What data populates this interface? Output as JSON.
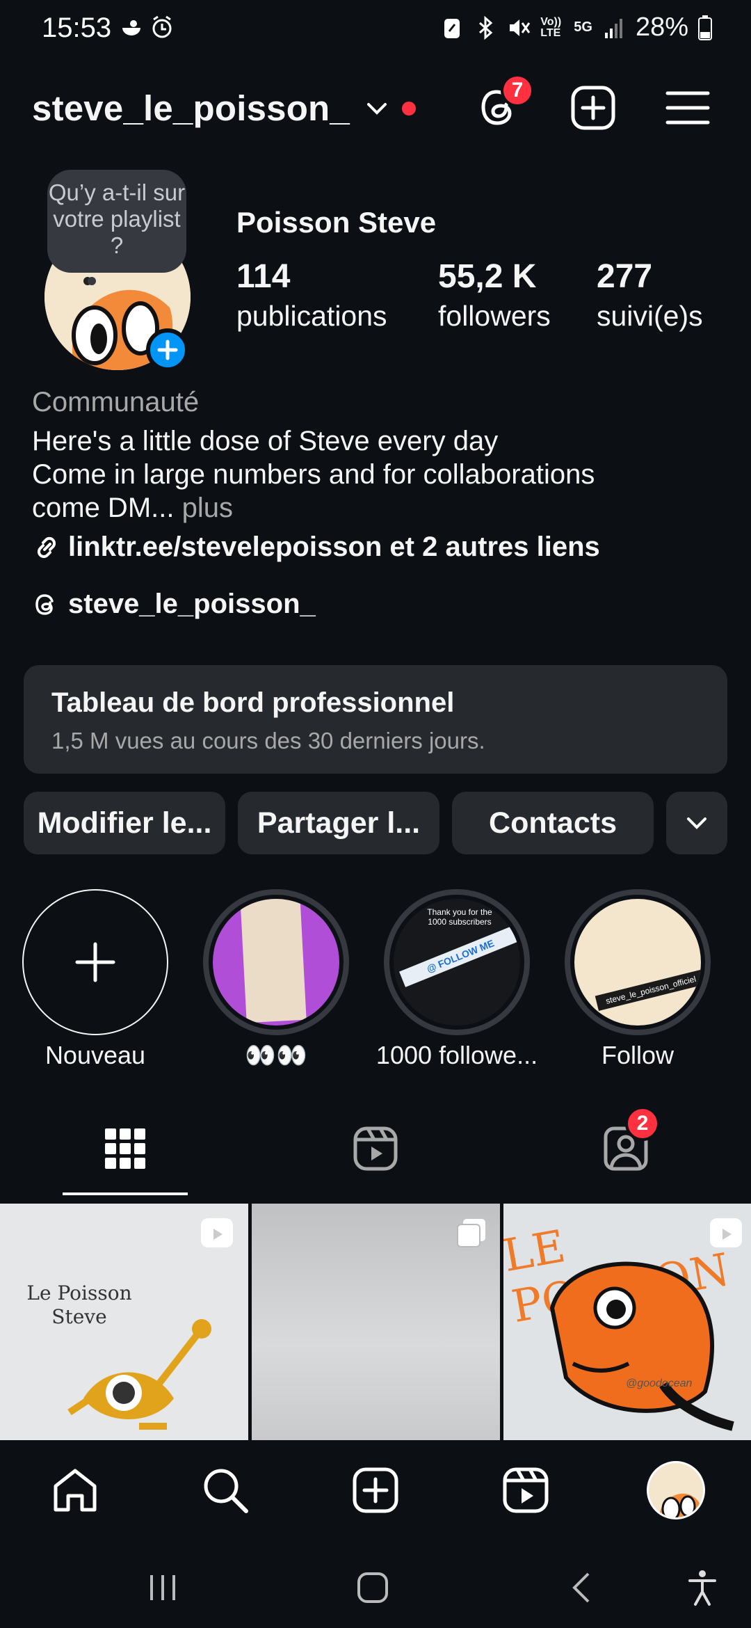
{
  "status_bar": {
    "time": "15:53",
    "battery": "28%",
    "network": "5G",
    "volte": "Vo)) LTE"
  },
  "header": {
    "username": "steve_le_poisson_",
    "threads_badge": "7"
  },
  "profile": {
    "note": "Qu’y a-t-il sur votre playlist ?",
    "display_name": "Poisson Steve",
    "stats": [
      {
        "value": "114",
        "label": "publications"
      },
      {
        "value": "55,2 K",
        "label": "followers"
      },
      {
        "value": "277",
        "label": "suivi(e)s"
      }
    ],
    "category": "Communauté",
    "bio_line1": "Here's a little dose of Steve every day",
    "bio_line2": "Come in large numbers and for collaborations",
    "bio_line3": "come DM...",
    "bio_more": " plus",
    "link": "linktr.ee/stevelepoisson et 2 autres liens",
    "threads_handle": "steve_le_poisson_"
  },
  "dashboard": {
    "title": "Tableau de bord professionnel",
    "subtitle": "1,5 M vues au cours des 30 derniers jours."
  },
  "buttons": {
    "edit": "Modifier le...",
    "share": "Partager l...",
    "contacts": "Contacts"
  },
  "highlights": [
    {
      "label": "Nouveau"
    },
    {
      "label": "👀👀"
    },
    {
      "label": "1000 followe..."
    },
    {
      "label": "Follow"
    }
  ],
  "highlight_texts": {
    "h3_text": "Thank you for the 1000 subscribers",
    "h3_tag": "@ FOLLOW ME",
    "h4_tag": "steve_le_poisson_officiel"
  },
  "tabs": {
    "tagged_badge": "2"
  },
  "grid": {
    "tile1_text": "Le Poisson Steve",
    "tile3_text": "LE POISSON",
    "tile3_credit": "@goodocean"
  },
  "colors": {
    "bg": "#0c1014",
    "card": "#262a2f",
    "badge": "#ff3040",
    "blue": "#0095f6"
  }
}
